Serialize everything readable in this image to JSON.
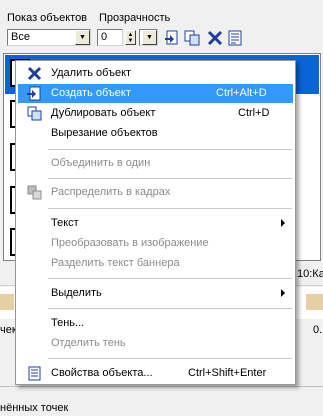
{
  "toolbar": {
    "show_objects_label": "Показ объектов",
    "transparency_label": "Прозрачность",
    "show_objects_value": "Все",
    "transparency_value": "0"
  },
  "background": {
    "right_header_text": "10:Ка",
    "left_bottom_text": "чек",
    "right_bottom_text": "0.",
    "status_text": "нённых точек"
  },
  "context_menu": {
    "items": [
      {
        "label": "Удалить объект",
        "shortcut": "",
        "icon": "delete-x-icon"
      },
      {
        "label": "Создать объект",
        "shortcut": "Ctrl+Alt+D",
        "icon": "create-object-icon"
      },
      {
        "label": "Дублировать объект",
        "shortcut": "Ctrl+D",
        "icon": "duplicate-object-icon"
      },
      {
        "label": "Вырезание объектов",
        "shortcut": ""
      },
      {
        "label": "Объединить в один",
        "shortcut": ""
      },
      {
        "label": "Распределить в кадрах",
        "shortcut": "",
        "icon": "distribute-frames-icon"
      },
      {
        "label": "Текст",
        "shortcut": ""
      },
      {
        "label": "Преобразовать в изображение",
        "shortcut": ""
      },
      {
        "label": "Разделить текст баннера",
        "shortcut": ""
      },
      {
        "label": "Выделить",
        "shortcut": ""
      },
      {
        "label": "Тень...",
        "shortcut": ""
      },
      {
        "label": "Отделить тень",
        "shortcut": ""
      },
      {
        "label": "Свойства объекта...",
        "shortcut": "Ctrl+Shift+Enter",
        "icon": "properties-icon"
      }
    ]
  },
  "colors": {
    "highlight": "#3399ff",
    "selection_row": "#0a64d8",
    "disabled_text": "#8c8c8c"
  }
}
